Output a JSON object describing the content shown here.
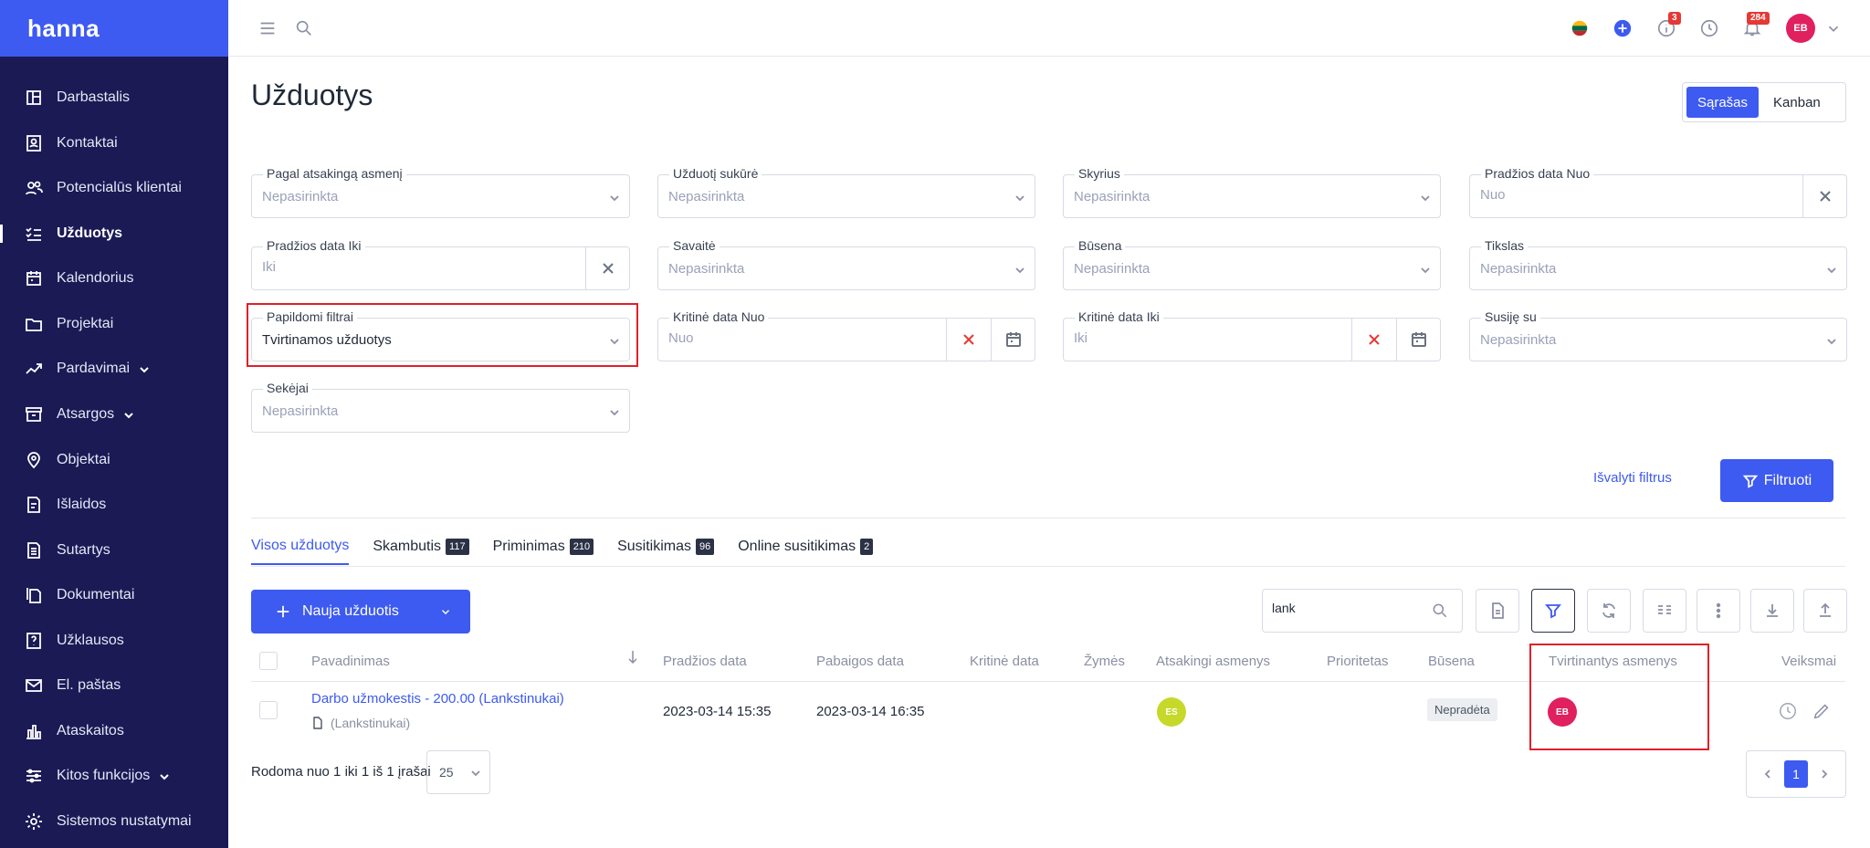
{
  "app": {
    "brand": "hanna"
  },
  "sidebar": {
    "items": [
      {
        "label": "Darbastalis",
        "icon": "dashboard-icon"
      },
      {
        "label": "Kontaktai",
        "icon": "contacts-icon"
      },
      {
        "label": "Potencialūs klientai",
        "icon": "people-icon"
      },
      {
        "label": "Užduotys",
        "icon": "tasks-icon",
        "active": true
      },
      {
        "label": "Kalendorius",
        "icon": "calendar-icon"
      },
      {
        "label": "Projektai",
        "icon": "folder-icon"
      },
      {
        "label": "Pardavimai",
        "icon": "trend-icon",
        "expandable": true
      },
      {
        "label": "Atsargos",
        "icon": "archive-icon",
        "expandable": true
      },
      {
        "label": "Objektai",
        "icon": "location-icon"
      },
      {
        "label": "Išlaidos",
        "icon": "expense-icon"
      },
      {
        "label": "Sutartys",
        "icon": "contract-icon"
      },
      {
        "label": "Dokumentai",
        "icon": "documents-icon"
      },
      {
        "label": "Užklausos",
        "icon": "question-icon"
      },
      {
        "label": "El. paštas",
        "icon": "mail-icon"
      },
      {
        "label": "Ataskaitos",
        "icon": "reports-icon"
      },
      {
        "label": "Kitos funkcijos",
        "icon": "sliders-icon",
        "expandable": true
      },
      {
        "label": "Sistemos nustatymai",
        "icon": "settings-icon"
      }
    ]
  },
  "topbar": {
    "info_badge": "3",
    "notif_badge": "284",
    "user_initials": "EB"
  },
  "page": {
    "title": "Užduotys",
    "view_list": "Sąrašas",
    "view_kanban": "Kanban"
  },
  "filters": {
    "responsible": {
      "label": "Pagal atsakingą asmenį",
      "value": "Nepasirinkta"
    },
    "creator": {
      "label": "Užduotį sukūrė",
      "value": "Nepasirinkta"
    },
    "department": {
      "label": "Skyrius",
      "value": "Nepasirinkta"
    },
    "start_from": {
      "label": "Pradžios data Nuo",
      "placeholder": "Nuo"
    },
    "start_to": {
      "label": "Pradžios data Iki",
      "placeholder": "Iki"
    },
    "week": {
      "label": "Savaitė",
      "value": "Nepasirinkta"
    },
    "status": {
      "label": "Būsena",
      "value": "Nepasirinkta"
    },
    "goal": {
      "label": "Tikslas",
      "value": "Nepasirinkta"
    },
    "extra": {
      "label": "Papildomi filtrai",
      "value": "Tvirtinamos užduotys"
    },
    "critical_from": {
      "label": "Kritinė data Nuo",
      "placeholder": "Nuo"
    },
    "critical_to": {
      "label": "Kritinė data Iki",
      "placeholder": "Iki"
    },
    "related": {
      "label": "Susiję su",
      "value": "Nepasirinkta"
    },
    "followers": {
      "label": "Sekėjai",
      "value": "Nepasirinkta"
    },
    "clear_label": "Išvalyti filtrus",
    "filter_label": "Filtruoti"
  },
  "tabs": [
    {
      "label": "Visos užduotys",
      "count": ""
    },
    {
      "label": "Skambutis",
      "count": "117"
    },
    {
      "label": "Priminimas",
      "count": "210"
    },
    {
      "label": "Susitikimas",
      "count": "96"
    },
    {
      "label": "Online susitikimas",
      "count": "2"
    }
  ],
  "toolbar": {
    "new_task": "Nauja užduotis",
    "search_value": "lank"
  },
  "table": {
    "headers": [
      "Pavadinimas",
      "Pradžios data",
      "Pabaigos data",
      "Kritinė data",
      "Žymės",
      "Atsakingi asmenys",
      "Prioritetas",
      "Būsena",
      "Tvirtinantys asmenys",
      "Veiksmai"
    ],
    "rows": [
      {
        "title": "Darbo užmokestis - 200.00 (Lankstinukai)",
        "sub": "(Lankstinukai)",
        "start": "2023-03-14 15:35",
        "end": "2023-03-14 16:35",
        "responsible": "ES",
        "status": "Nepradėta",
        "approver": "EB"
      }
    ]
  },
  "footer": {
    "summary": "Rodoma nuo 1 iki 1 iš 1 įrašai",
    "page_size": "25",
    "current_page": "1"
  },
  "colors": {
    "sidebar_bg": "#1b1a55",
    "brand_bg": "#3d5af1",
    "accent": "#3d5af1",
    "avatar_eb": "#e0205f",
    "avatar_es": "#c6d92a",
    "highlight": "#e0202a"
  }
}
